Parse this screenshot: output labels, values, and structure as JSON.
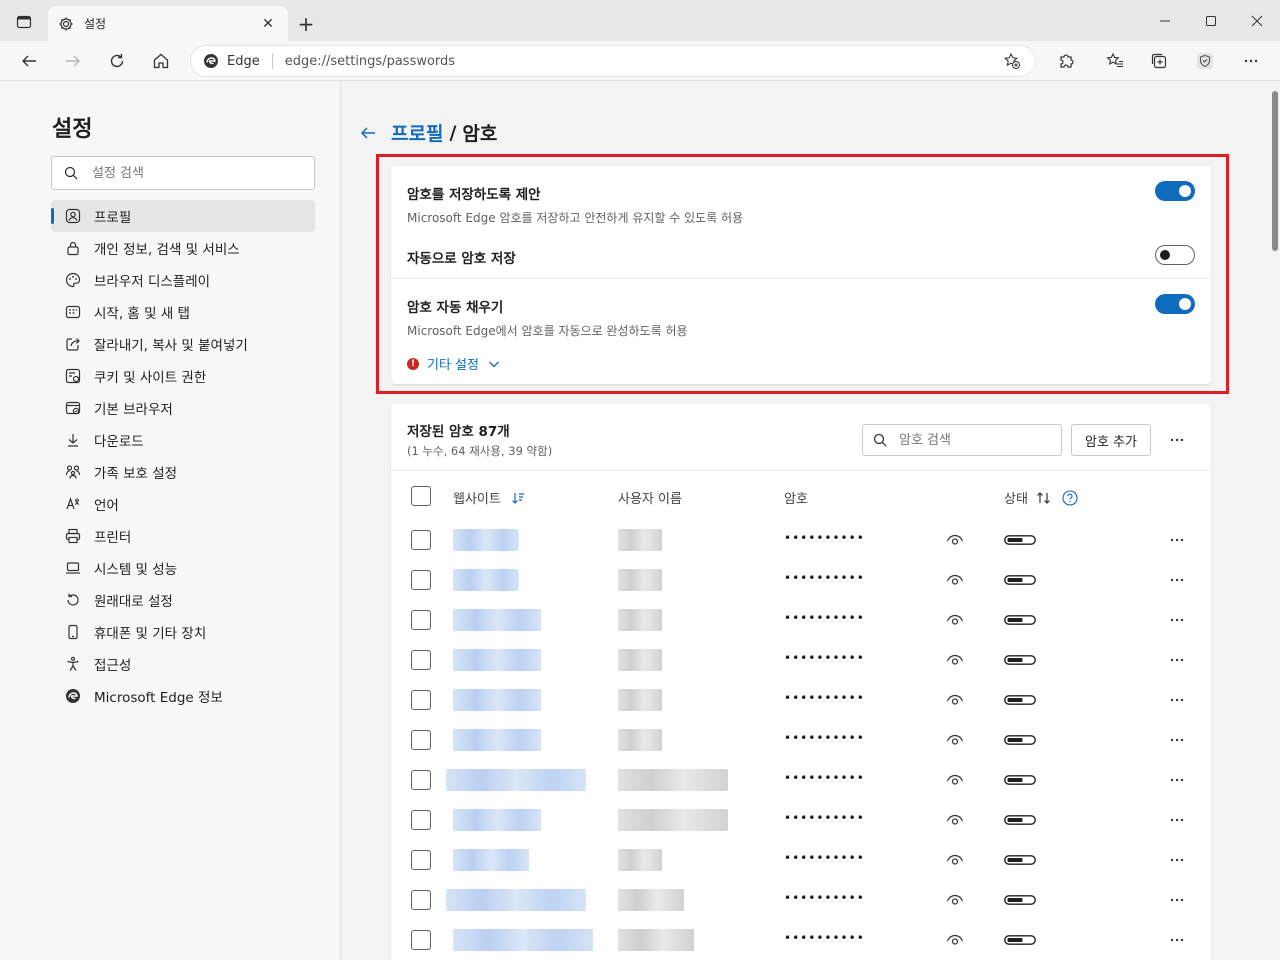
{
  "tab": {
    "title": "설정"
  },
  "address": {
    "edge_label": "Edge",
    "url": "edge://settings/passwords"
  },
  "sidebar": {
    "title": "설정",
    "search_placeholder": "설정 검색",
    "items": [
      {
        "label": "프로필",
        "icon": "profile-icon",
        "active": true
      },
      {
        "label": "개인 정보, 검색 및 서비스",
        "icon": "lock-icon"
      },
      {
        "label": "브라우저 디스플레이",
        "icon": "palette-icon"
      },
      {
        "label": "시작, 홈 및 새 탭",
        "icon": "start-page-icon"
      },
      {
        "label": "잘라내기, 복사 및 붙여넣기",
        "icon": "share-icon"
      },
      {
        "label": "쿠키 및 사이트 권한",
        "icon": "cookie-icon"
      },
      {
        "label": "기본 브라우저",
        "icon": "default-browser-icon"
      },
      {
        "label": "다운로드",
        "icon": "download-icon"
      },
      {
        "label": "가족 보호 설정",
        "icon": "family-icon"
      },
      {
        "label": "언어",
        "icon": "language-icon"
      },
      {
        "label": "프린터",
        "icon": "printer-icon"
      },
      {
        "label": "시스템 및 성능",
        "icon": "laptop-icon"
      },
      {
        "label": "원래대로 설정",
        "icon": "reset-icon"
      },
      {
        "label": "휴대폰 및 기타 장치",
        "icon": "phone-icon"
      },
      {
        "label": "접근성",
        "icon": "accessibility-icon"
      },
      {
        "label": "Microsoft Edge 정보",
        "icon": "edge-logo-icon"
      }
    ]
  },
  "breadcrumb": {
    "parent": "프로필",
    "separator": "/",
    "current": "암호"
  },
  "settings": {
    "offer_save": {
      "title": "암호를 저장하도록 제안",
      "desc": "Microsoft Edge 암호를 저장하고 안전하게 유지할 수 있도록 허용",
      "on": true
    },
    "auto_save": {
      "title": "자동으로 암호 저장",
      "on": false
    },
    "autofill": {
      "title": "암호 자동 채우기",
      "desc": "Microsoft Edge에서 암호를 자동으로 완성하도록 허용",
      "on": true
    },
    "more_label": "기타 설정"
  },
  "saved": {
    "title": "저장된 암호 87개",
    "subtitle": "(1 누수, 64 재사용, 39 약함)",
    "search_placeholder": "암호 검색",
    "add_label": "암호 추가",
    "columns": {
      "site": "웹사이트",
      "user": "사용자 이름",
      "password": "암호",
      "status": "상태"
    },
    "masked_password": "••••••••••",
    "row_count": 11
  },
  "colors": {
    "accent": "#0f6cbd",
    "highlight": "#e21d24",
    "warning": "#c42b1c"
  }
}
